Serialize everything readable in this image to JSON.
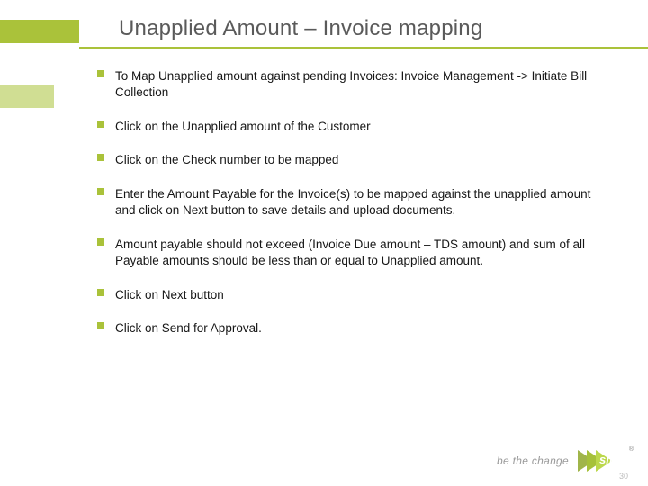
{
  "title": "Unapplied Amount – Invoice mapping",
  "bullets": [
    "To Map Unapplied amount against pending Invoices: Invoice Management -> Initiate Bill Collection",
    "Click on the Unapplied amount of the Customer",
    "Click on the Check number to be mapped",
    "Enter the Amount Payable for the Invoice(s) to be mapped against the unapplied amount and click on Next button to save details and upload documents.",
    "Amount payable should not exceed (Invoice Due amount – TDS amount) and sum of all Payable amounts should be less than or equal to Unapplied amount.",
    "Click on Next button",
    "Click on Send for Approval."
  ],
  "footer": {
    "tagline": "be the change",
    "brand": "sify",
    "registered": "®",
    "slide_number": "30"
  }
}
